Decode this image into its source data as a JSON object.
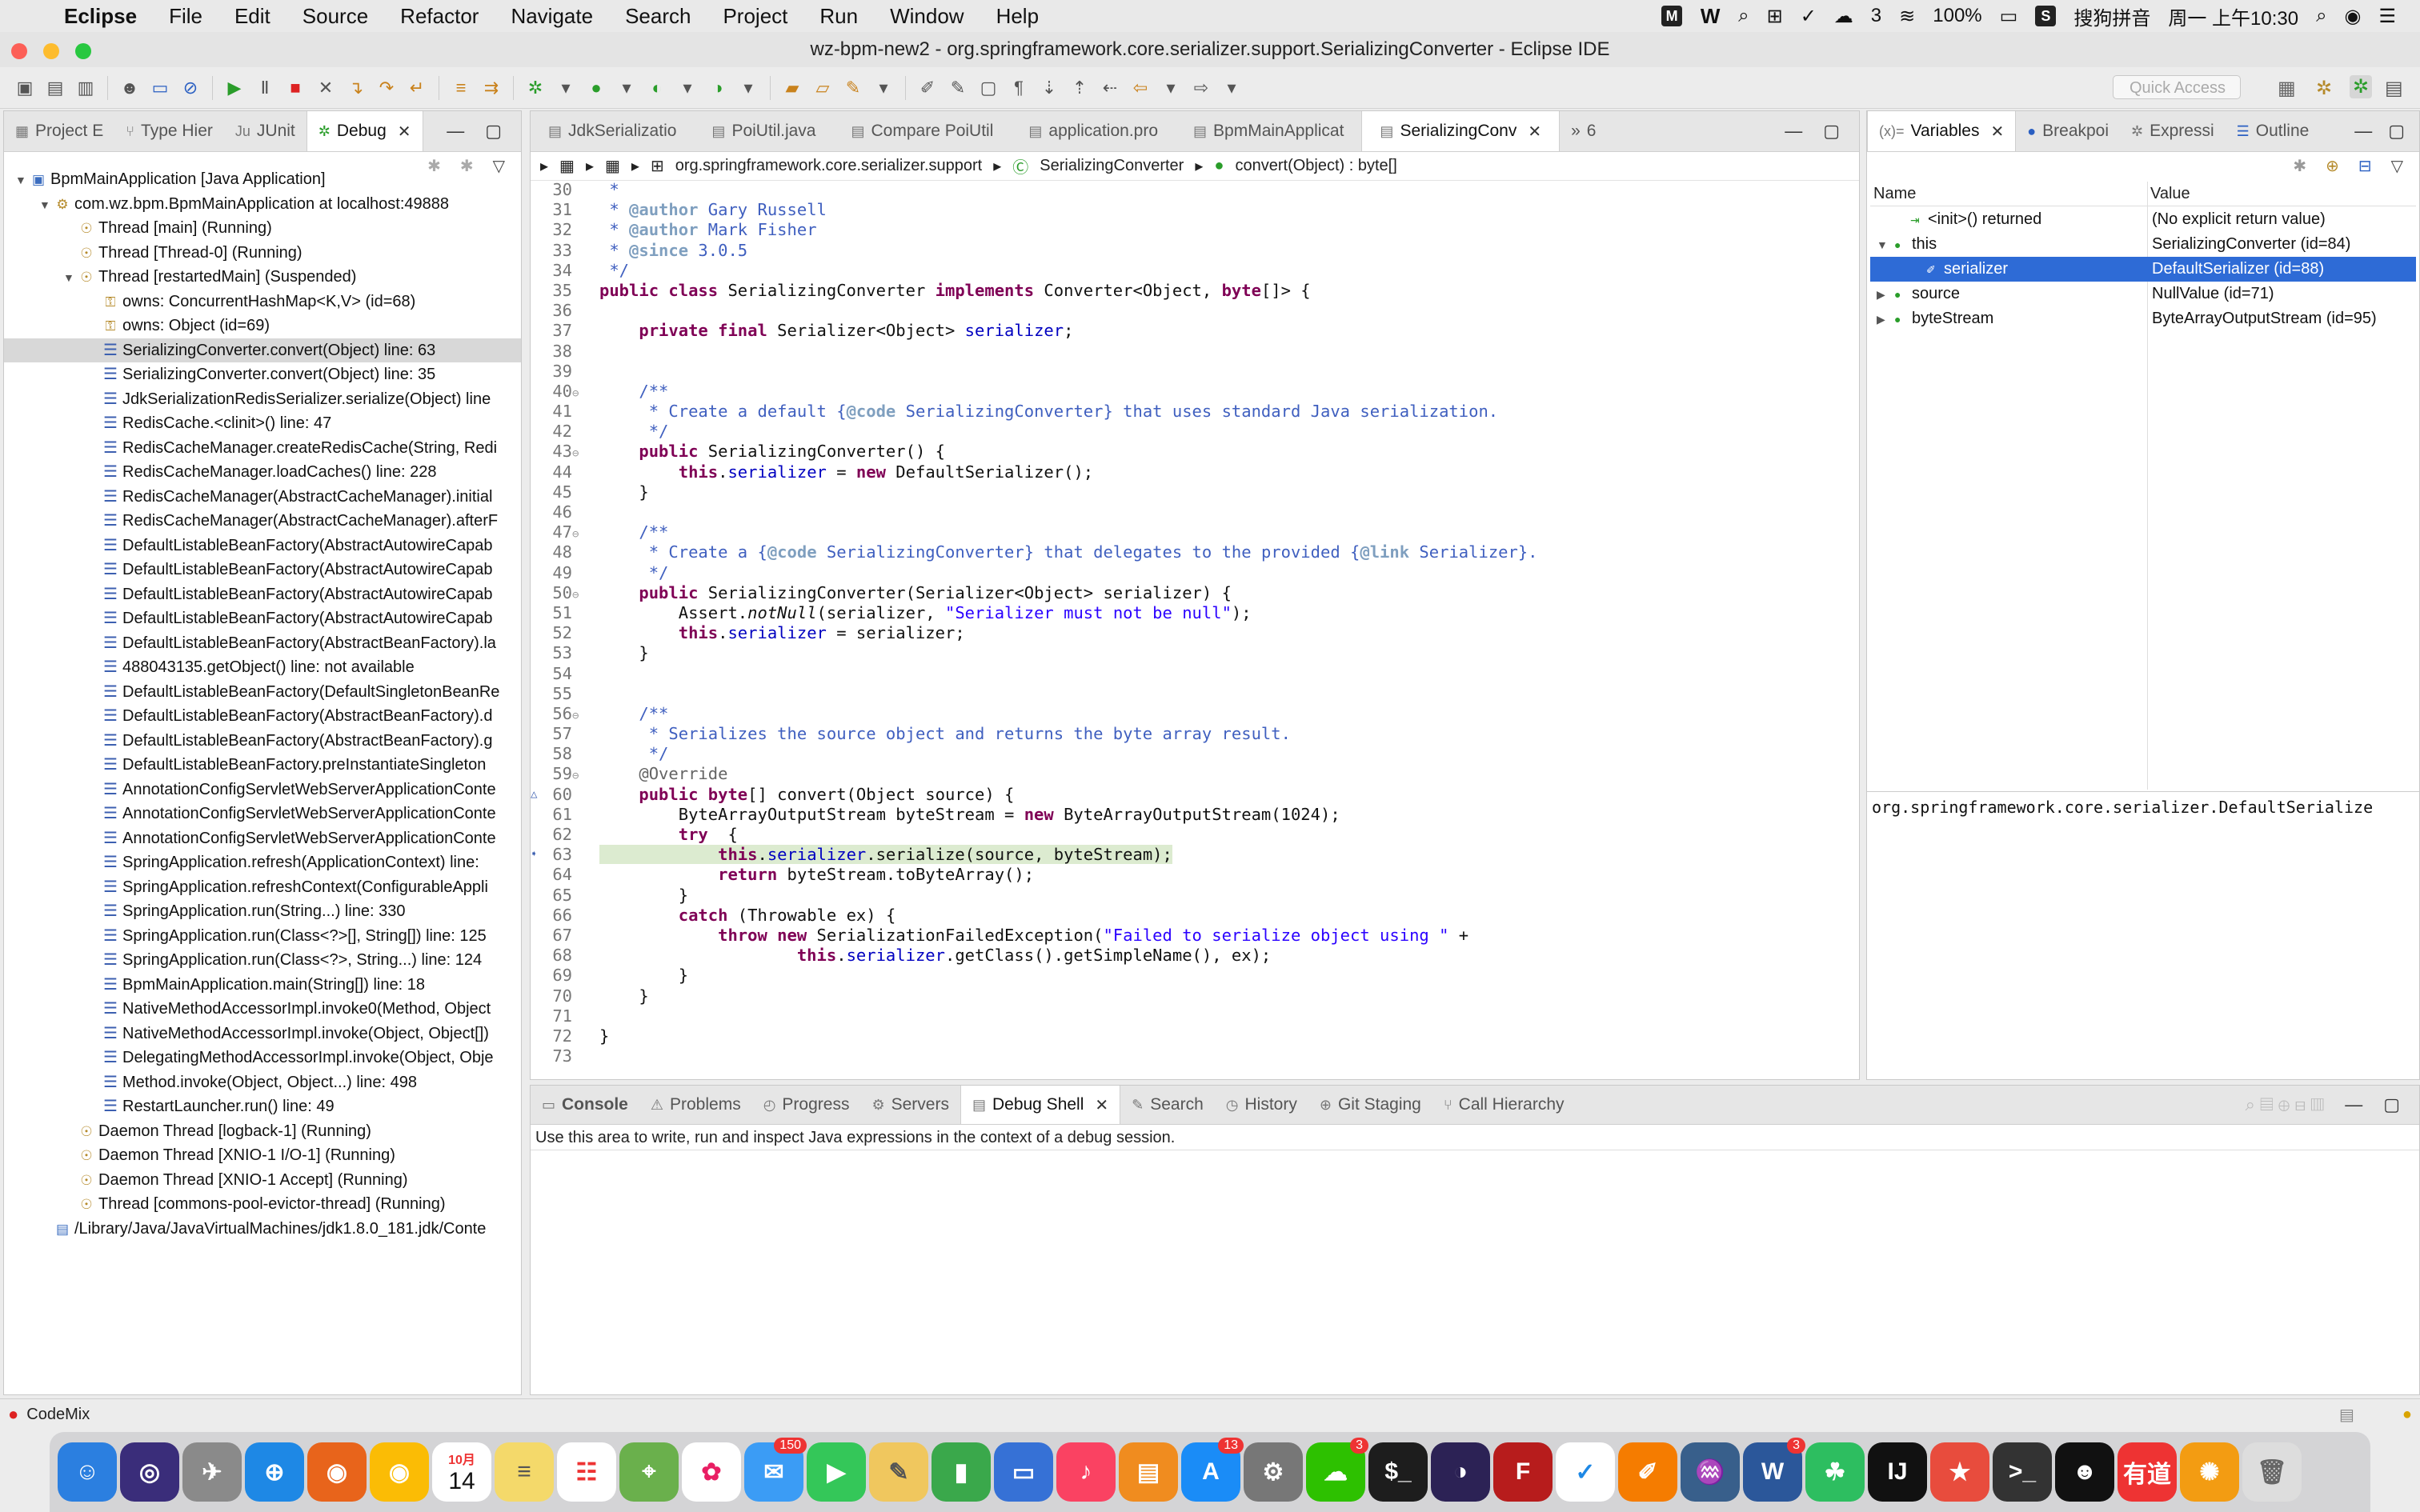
{
  "menubar": {
    "app": "Eclipse",
    "items": [
      "File",
      "Edit",
      "Source",
      "Refactor",
      "Navigate",
      "Search",
      "Project",
      "Run",
      "Window",
      "Help"
    ],
    "status_badge": "3",
    "battery": "100%",
    "ime": "搜狗拼音",
    "clock": "周一 上午10:30"
  },
  "window": {
    "title": "wz-bpm-new2 - org.springframework.core.serializer.support.SerializingConverter - Eclipse IDE"
  },
  "toolbar": {
    "quick_access": "Quick Access"
  },
  "debug_view": {
    "tabs": [
      "Project E",
      "Type Hier",
      "JUnit",
      "Debug"
    ],
    "active_tab": "Debug",
    "rows": [
      {
        "indent": 0,
        "twisty": "open",
        "icon": "app",
        "text": "BpmMainApplication [Java Application]"
      },
      {
        "indent": 1,
        "twisty": "open",
        "icon": "process",
        "text": "com.wz.bpm.BpmMainApplication at localhost:49888"
      },
      {
        "indent": 2,
        "twisty": "",
        "icon": "thread",
        "text": "Thread [main] (Running)"
      },
      {
        "indent": 2,
        "twisty": "",
        "icon": "thread",
        "text": "Thread [Thread-0] (Running)"
      },
      {
        "indent": 2,
        "twisty": "open",
        "icon": "thread",
        "text": "Thread [restartedMain] (Suspended)"
      },
      {
        "indent": 3,
        "twisty": "",
        "icon": "lock",
        "text": "owns: ConcurrentHashMap<K,V>  (id=68)"
      },
      {
        "indent": 3,
        "twisty": "",
        "icon": "lock",
        "text": "owns: Object  (id=69)"
      },
      {
        "indent": 3,
        "twisty": "",
        "icon": "stack",
        "text": "SerializingConverter.convert(Object) line: 63",
        "selected": true
      },
      {
        "indent": 3,
        "twisty": "",
        "icon": "stack",
        "text": "SerializingConverter.convert(Object) line: 35"
      },
      {
        "indent": 3,
        "twisty": "",
        "icon": "stack",
        "text": "JdkSerializationRedisSerializer.serialize(Object) line"
      },
      {
        "indent": 3,
        "twisty": "",
        "icon": "stack",
        "text": "RedisCache.<clinit>() line: 47"
      },
      {
        "indent": 3,
        "twisty": "",
        "icon": "stack",
        "text": "RedisCacheManager.createRedisCache(String, Redi"
      },
      {
        "indent": 3,
        "twisty": "",
        "icon": "stack",
        "text": "RedisCacheManager.loadCaches() line: 228"
      },
      {
        "indent": 3,
        "twisty": "",
        "icon": "stack",
        "text": "RedisCacheManager(AbstractCacheManager).initial"
      },
      {
        "indent": 3,
        "twisty": "",
        "icon": "stack",
        "text": "RedisCacheManager(AbstractCacheManager).afterF"
      },
      {
        "indent": 3,
        "twisty": "",
        "icon": "stack",
        "text": "DefaultListableBeanFactory(AbstractAutowireCapab"
      },
      {
        "indent": 3,
        "twisty": "",
        "icon": "stack",
        "text": "DefaultListableBeanFactory(AbstractAutowireCapab"
      },
      {
        "indent": 3,
        "twisty": "",
        "icon": "stack",
        "text": "DefaultListableBeanFactory(AbstractAutowireCapab"
      },
      {
        "indent": 3,
        "twisty": "",
        "icon": "stack",
        "text": "DefaultListableBeanFactory(AbstractAutowireCapab"
      },
      {
        "indent": 3,
        "twisty": "",
        "icon": "stack",
        "text": "DefaultListableBeanFactory(AbstractBeanFactory).la"
      },
      {
        "indent": 3,
        "twisty": "",
        "icon": "stack",
        "text": "488043135.getObject() line: not available"
      },
      {
        "indent": 3,
        "twisty": "",
        "icon": "stack",
        "text": "DefaultListableBeanFactory(DefaultSingletonBeanRe"
      },
      {
        "indent": 3,
        "twisty": "",
        "icon": "stack",
        "text": "DefaultListableBeanFactory(AbstractBeanFactory).d"
      },
      {
        "indent": 3,
        "twisty": "",
        "icon": "stack",
        "text": "DefaultListableBeanFactory(AbstractBeanFactory).g"
      },
      {
        "indent": 3,
        "twisty": "",
        "icon": "stack",
        "text": "DefaultListableBeanFactory.preInstantiateSingleton"
      },
      {
        "indent": 3,
        "twisty": "",
        "icon": "stack",
        "text": "AnnotationConfigServletWebServerApplicationConte"
      },
      {
        "indent": 3,
        "twisty": "",
        "icon": "stack",
        "text": "AnnotationConfigServletWebServerApplicationConte"
      },
      {
        "indent": 3,
        "twisty": "",
        "icon": "stack",
        "text": "AnnotationConfigServletWebServerApplicationConte"
      },
      {
        "indent": 3,
        "twisty": "",
        "icon": "stack",
        "text": "SpringApplication.refresh(ApplicationContext) line:"
      },
      {
        "indent": 3,
        "twisty": "",
        "icon": "stack",
        "text": "SpringApplication.refreshContext(ConfigurableAppli"
      },
      {
        "indent": 3,
        "twisty": "",
        "icon": "stack",
        "text": "SpringApplication.run(String...) line: 330"
      },
      {
        "indent": 3,
        "twisty": "",
        "icon": "stack",
        "text": "SpringApplication.run(Class<?>[], String[]) line: 125"
      },
      {
        "indent": 3,
        "twisty": "",
        "icon": "stack",
        "text": "SpringApplication.run(Class<?>, String...) line: 124"
      },
      {
        "indent": 3,
        "twisty": "",
        "icon": "stack",
        "text": "BpmMainApplication.main(String[]) line: 18"
      },
      {
        "indent": 3,
        "twisty": "",
        "icon": "stack",
        "text": "NativeMethodAccessorImpl.invoke0(Method, Object"
      },
      {
        "indent": 3,
        "twisty": "",
        "icon": "stack",
        "text": "NativeMethodAccessorImpl.invoke(Object, Object[])"
      },
      {
        "indent": 3,
        "twisty": "",
        "icon": "stack",
        "text": "DelegatingMethodAccessorImpl.invoke(Object, Obje"
      },
      {
        "indent": 3,
        "twisty": "",
        "icon": "stack",
        "text": "Method.invoke(Object, Object...) line: 498"
      },
      {
        "indent": 3,
        "twisty": "",
        "icon": "stack",
        "text": "RestartLauncher.run() line: 49"
      },
      {
        "indent": 2,
        "twisty": "",
        "icon": "thread",
        "text": "Daemon Thread [logback-1] (Running)"
      },
      {
        "indent": 2,
        "twisty": "",
        "icon": "thread",
        "text": "Daemon Thread [XNIO-1 I/O-1] (Running)"
      },
      {
        "indent": 2,
        "twisty": "",
        "icon": "thread",
        "text": "Daemon Thread [XNIO-1 Accept] (Running)"
      },
      {
        "indent": 2,
        "twisty": "",
        "icon": "thread",
        "text": "Thread [commons-pool-evictor-thread] (Running)"
      },
      {
        "indent": 1,
        "twisty": "",
        "icon": "jvm",
        "text": "/Library/Java/JavaVirtualMachines/jdk1.8.0_181.jdk/Conte"
      }
    ]
  },
  "editor": {
    "tabs": [
      "JdkSerializatio",
      "PoiUtil.java",
      "Compare PoiUtil",
      "application.pro",
      "BpmMainApplicat",
      "SerializingConv"
    ],
    "active_tab": "SerializingConv",
    "overflow": "6",
    "breadcrumb": [
      "org.springframework.core.serializer.support",
      "SerializingConverter",
      "convert(Object) : byte[]"
    ],
    "current_line": 63,
    "lines": [
      {
        "n": 30,
        "fold": "",
        "html": "<span class='cm'> *</span>"
      },
      {
        "n": 31,
        "fold": "",
        "html": "<span class='cm'> * </span><span class='tag'>@author</span><span class='cm'> Gary Russell</span>"
      },
      {
        "n": 32,
        "fold": "",
        "html": "<span class='cm'> * </span><span class='tag'>@author</span><span class='cm'> Mark Fisher</span>"
      },
      {
        "n": 33,
        "fold": "",
        "html": "<span class='cm'> * </span><span class='tag'>@since</span><span class='cm'> 3.0.5</span>"
      },
      {
        "n": 34,
        "fold": "",
        "html": "<span class='cm'> */</span>"
      },
      {
        "n": 35,
        "fold": "",
        "html": "<span class='kw'>public class</span> SerializingConverter <span class='kw'>implements</span> Converter&lt;Object, <span class='kw'>byte</span>[]&gt; {"
      },
      {
        "n": 36,
        "fold": "",
        "html": ""
      },
      {
        "n": 37,
        "fold": "",
        "html": "    <span class='kw'>private final</span> Serializer&lt;Object&gt; <span class='fld'>serializer</span>;"
      },
      {
        "n": 38,
        "fold": "",
        "html": ""
      },
      {
        "n": 39,
        "fold": "",
        "html": ""
      },
      {
        "n": 40,
        "fold": "⊖",
        "html": "    <span class='cm'>/**</span>"
      },
      {
        "n": 41,
        "fold": "",
        "html": "<span class='cm'>     * Create a default {</span><span class='tag'>@code</span><span class='cm'> SerializingConverter} that uses standard Java serialization.</span>"
      },
      {
        "n": 42,
        "fold": "",
        "html": "<span class='cm'>     */</span>"
      },
      {
        "n": 43,
        "fold": "⊖",
        "html": "    <span class='kw'>public</span> SerializingConverter() {"
      },
      {
        "n": 44,
        "fold": "",
        "html": "        <span class='kw'>this</span>.<span class='fld'>serializer</span> = <span class='kw'>new</span> DefaultSerializer();"
      },
      {
        "n": 45,
        "fold": "",
        "html": "    }"
      },
      {
        "n": 46,
        "fold": "",
        "html": ""
      },
      {
        "n": 47,
        "fold": "⊖",
        "html": "    <span class='cm'>/**</span>"
      },
      {
        "n": 48,
        "fold": "",
        "html": "<span class='cm'>     * Create a {</span><span class='tag'>@code</span><span class='cm'> SerializingConverter} that delegates to the provided {</span><span class='tag'>@link</span><span class='cm'> Serializer}.</span>"
      },
      {
        "n": 49,
        "fold": "",
        "html": "<span class='cm'>     */</span>"
      },
      {
        "n": 50,
        "fold": "⊖",
        "html": "    <span class='kw'>public</span> SerializingConverter(Serializer&lt;Object&gt; serializer) {"
      },
      {
        "n": 51,
        "fold": "",
        "html": "        Assert.<i>notNull</i>(serializer, <span class='str'>\"Serializer must not be null\"</span>);"
      },
      {
        "n": 52,
        "fold": "",
        "html": "        <span class='kw'>this</span>.<span class='fld'>serializer</span> = serializer;"
      },
      {
        "n": 53,
        "fold": "",
        "html": "    }"
      },
      {
        "n": 54,
        "fold": "",
        "html": ""
      },
      {
        "n": 55,
        "fold": "",
        "html": ""
      },
      {
        "n": 56,
        "fold": "⊖",
        "html": "    <span class='cm'>/**</span>"
      },
      {
        "n": 57,
        "fold": "",
        "html": "<span class='cm'>     * Serializes the source object and returns the byte array result.</span>"
      },
      {
        "n": 58,
        "fold": "",
        "html": "<span class='cm'>     */</span>"
      },
      {
        "n": 59,
        "fold": "⊖",
        "html": "    <span class='ann'>@Override</span>"
      },
      {
        "n": 60,
        "fold": "",
        "html": "    <span class='kw'>public byte</span>[] convert(Object source) {"
      },
      {
        "n": 61,
        "fold": "",
        "html": "        ByteArrayOutputStream byteStream = <span class='kw'>new</span> ByteArrayOutputStream(1024);"
      },
      {
        "n": 62,
        "fold": "",
        "html": "        <span class='kw'>try</span>  {"
      },
      {
        "n": 63,
        "fold": "",
        "html": "            <span class='kw'>this</span>.<span class='fld'>serializer</span>.serialize(source, byteStream);"
      },
      {
        "n": 64,
        "fold": "",
        "html": "            <span class='kw'>return</span> byteStream.toByteArray();"
      },
      {
        "n": 65,
        "fold": "",
        "html": "        }"
      },
      {
        "n": 66,
        "fold": "",
        "html": "        <span class='kw'>catch</span> (Throwable ex) {"
      },
      {
        "n": 67,
        "fold": "",
        "html": "            <span class='kw'>throw new</span> SerializationFailedException(<span class='str'>\"Failed to serialize object using \"</span> +"
      },
      {
        "n": 68,
        "fold": "",
        "html": "                    <span class='kw'>this</span>.<span class='fld'>serializer</span>.getClass().getSimpleName(), ex);"
      },
      {
        "n": 69,
        "fold": "",
        "html": "        }"
      },
      {
        "n": 70,
        "fold": "",
        "html": "    }"
      },
      {
        "n": 71,
        "fold": "",
        "html": ""
      },
      {
        "n": 72,
        "fold": "",
        "html": "}"
      },
      {
        "n": 73,
        "fold": "",
        "html": ""
      }
    ]
  },
  "variables_view": {
    "tabs": [
      "Variables",
      "Breakpoi",
      "Expressi",
      "Outline"
    ],
    "active_tab": "Variables",
    "prefix": "(x)=",
    "columns": [
      "Name",
      "Value"
    ],
    "rows": [
      {
        "indent": 1,
        "twisty": "",
        "name": "<init>() returned",
        "value": "(No explicit return value)"
      },
      {
        "indent": 0,
        "twisty": "open",
        "name": "this",
        "value": "SerializingConverter  (id=84)"
      },
      {
        "indent": 2,
        "twisty": "",
        "name": "serializer",
        "value": "DefaultSerializer  (id=88)",
        "selected": true
      },
      {
        "indent": 0,
        "twisty": "closed",
        "name": "source",
        "value": "NullValue  (id=71)"
      },
      {
        "indent": 0,
        "twisty": "closed",
        "name": "byteStream",
        "value": "ByteArrayOutputStream  (id=95)"
      }
    ],
    "detail": "org.springframework.core.serializer.DefaultSerialize"
  },
  "bottom_view": {
    "tabs": [
      "Console",
      "Problems",
      "Progress",
      "Servers",
      "Debug Shell",
      "Search",
      "History",
      "Git Staging",
      "Call Hierarchy"
    ],
    "active_tab": "Debug Shell",
    "message": "Use this area to write, run and inspect Java expressions in the context of a debug session."
  },
  "statusbar": {
    "text": "CodeMix"
  },
  "dock": {
    "calendar_month": "10月",
    "calendar_day": "14",
    "badges": {
      "messages": "150",
      "appstore": "13",
      "wechat": "3",
      "word": "3"
    }
  },
  "colors": {
    "selection": "#2e6bd6",
    "current_line": "#dcebd0",
    "keyword": "#7f0055",
    "comment": "#3f5fbf"
  }
}
